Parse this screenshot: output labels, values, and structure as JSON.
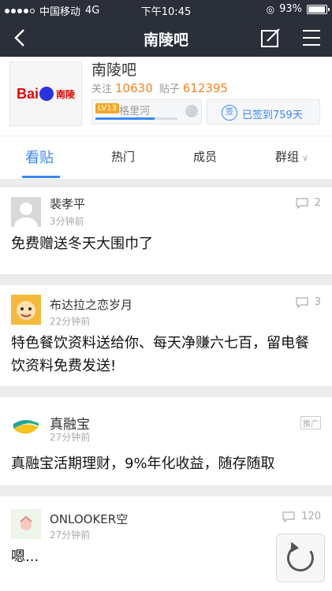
{
  "status": {
    "carrier": "中国移动",
    "network": "4G",
    "time": "下午10:45",
    "battery": "93%"
  },
  "nav": {
    "title": "南陵吧"
  },
  "forum": {
    "logo_text": "Bai",
    "logo_sub": "南陵",
    "name": "南陵吧",
    "follow_label": "关注",
    "follow_count": "10630",
    "posts_label": "贴子",
    "posts_count": "612395",
    "level_badge": "LV13",
    "level_name": "格里河",
    "level_progress": 0.72,
    "signed_text": "已签到759天",
    "signed_icon_text": "签"
  },
  "tabs": [
    {
      "label": "看贴"
    },
    {
      "label": "热门"
    },
    {
      "label": "成员"
    },
    {
      "label": "群组"
    }
  ],
  "posts": [
    {
      "user": "裴孝平",
      "time": "3分钟前",
      "text": "免费赠送冬天大围巾了",
      "replies": "2"
    },
    {
      "user": "布达拉之恋岁月",
      "time": "22分钟前",
      "text": "特色餐饮资料送给你、每天净赚六七百，留电餐饮资料免费发送!",
      "replies": "3"
    },
    {
      "user": "真融宝",
      "time": "27分钟前",
      "text": "真融宝活期理财，9%年化收益，随存随取",
      "ad_tag": "推广"
    },
    {
      "user": "ONLOOKER空",
      "time": "27分钟前",
      "text": "嗯...",
      "replies": "120"
    }
  ]
}
